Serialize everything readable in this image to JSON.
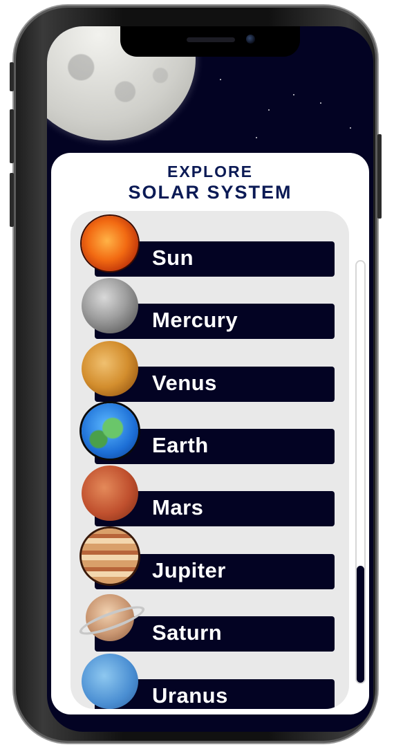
{
  "header": {
    "title_line1": "EXPLORE",
    "title_line2": "SOLAR SYSTEM"
  },
  "planets": [
    {
      "name": "Sun",
      "icon": "sun-icon"
    },
    {
      "name": "Mercury",
      "icon": "mercury-icon"
    },
    {
      "name": "Venus",
      "icon": "venus-icon"
    },
    {
      "name": "Earth",
      "icon": "earth-icon"
    },
    {
      "name": "Mars",
      "icon": "mars-icon"
    },
    {
      "name": "Jupiter",
      "icon": "jupiter-icon"
    },
    {
      "name": "Saturn",
      "icon": "saturn-icon"
    },
    {
      "name": "Uranus",
      "icon": "uranus-icon"
    }
  ],
  "scrollbar": {
    "thumb_fraction": 0.28,
    "position": "near bottom"
  },
  "colors": {
    "background": "#030323",
    "card": "#ffffff",
    "list_bg": "#e9e9e9",
    "bar": "#030323",
    "title": "#0b1a55",
    "label": "#ffffff"
  }
}
